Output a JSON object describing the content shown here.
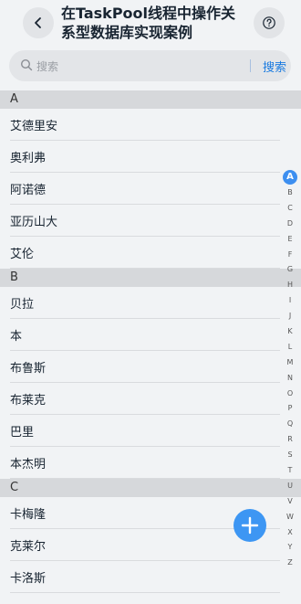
{
  "header": {
    "back_icon": "chevron-left-icon",
    "title": "在TaskPool线程中操作关系型数据库实现案例",
    "help_icon": "question-circle-icon"
  },
  "search": {
    "icon": "search-icon",
    "placeholder": "搜索",
    "button_label": "搜索"
  },
  "groups": [
    {
      "letter": "A",
      "items": [
        "艾德里安",
        "奥利弗",
        "阿诺德",
        "亚历山大",
        "艾伦"
      ]
    },
    {
      "letter": "B",
      "items": [
        "贝拉",
        "本",
        "布鲁斯",
        "布莱克",
        "巴里",
        "本杰明"
      ]
    },
    {
      "letter": "C",
      "items": [
        "卡梅隆",
        "克莱尔",
        "卡洛斯"
      ]
    }
  ],
  "alphabet": {
    "active": "A",
    "letters": [
      "A",
      "B",
      "C",
      "D",
      "E",
      "F",
      "G",
      "H",
      "I",
      "J",
      "K",
      "L",
      "M",
      "N",
      "O",
      "P",
      "Q",
      "R",
      "S",
      "T",
      "U",
      "V",
      "W",
      "X",
      "Y",
      "Z"
    ]
  },
  "fab": {
    "icon": "plus-icon"
  },
  "colors": {
    "accent": "#3d96f3",
    "background": "#f1f3f5"
  }
}
